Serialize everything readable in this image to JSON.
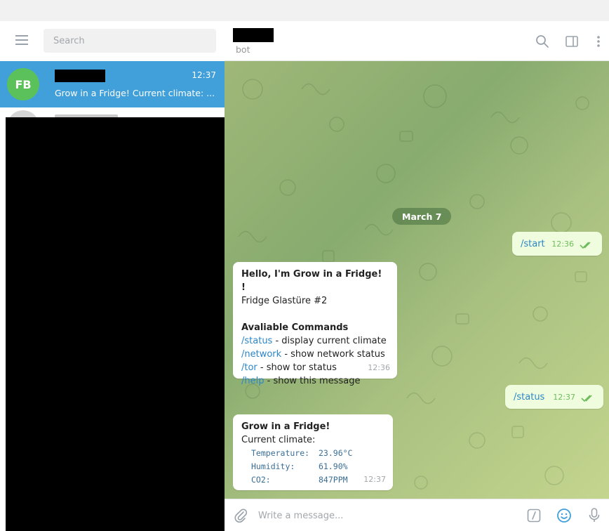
{
  "left": {
    "search": {
      "placeholder": "Search",
      "value": ""
    },
    "chats": [
      {
        "avatar_initials": "FB",
        "time": "12:37",
        "preview": "Grow in a Fridge! Current climate: ...",
        "avatar_color": "#5bc25b"
      }
    ]
  },
  "chat": {
    "status": "bot",
    "date_separator": "March 7",
    "messages": {
      "start": {
        "text": "/start",
        "time": "12:36"
      },
      "menu": {
        "title": "Hello, I'm Grow in a Fridge! !",
        "subtitle": "Fridge Glastüre #2",
        "commands_heading": "Avaliable Commands",
        "commands": [
          {
            "cmd": "/status",
            "desc": " - display current climate"
          },
          {
            "cmd": "/network",
            "desc": " - show network status"
          },
          {
            "cmd": "/tor",
            "desc": " - show tor status"
          },
          {
            "cmd": "/help",
            "desc": " - show this message"
          }
        ],
        "time": "12:36"
      },
      "status_out": {
        "text": "/status",
        "time": "12:37"
      },
      "climate": {
        "title": "Grow in a Fridge!",
        "subtitle": "Current climate:",
        "rows": [
          {
            "label": "Temperature:",
            "value": "23.96°C"
          },
          {
            "label": "Humidity:",
            "value": "61.90%"
          },
          {
            "label": "CO2:",
            "value": "847PPM"
          }
        ],
        "time": "12:37"
      }
    },
    "composer": {
      "placeholder": "Write a message..."
    }
  },
  "colors": {
    "accent": "#419fd9",
    "outgoing_bubble": "#effdde",
    "link": "#2a86c8"
  }
}
